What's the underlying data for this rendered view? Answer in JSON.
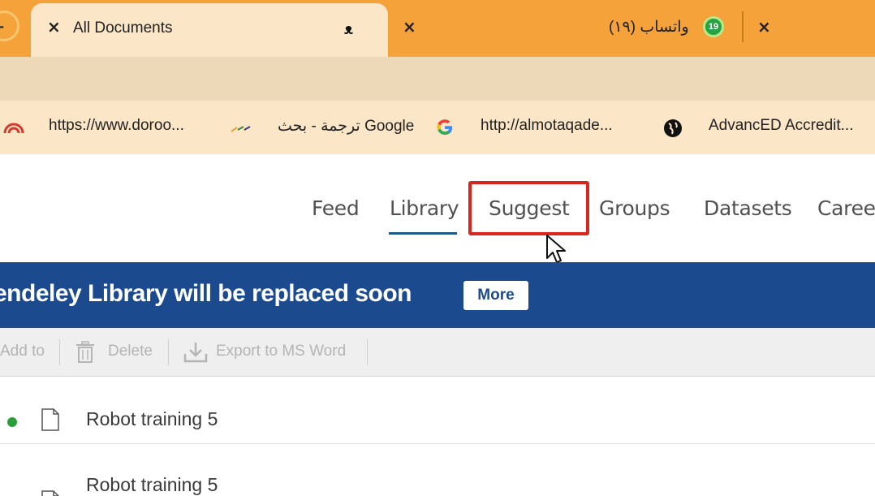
{
  "browser": {
    "profile_initial": "-",
    "tabs": [
      {
        "title": "All Documents",
        "close": "×",
        "favicon": "mendeley-icon",
        "favicon_glyph": "ᴥ"
      },
      {
        "title": "(١٩) واتساب",
        "close": "×",
        "badge": "19",
        "favicon": "whatsapp-icon"
      }
    ],
    "extra_tab_close": "×",
    "colors": {
      "tabstrip": "#f6a23a",
      "active_tab": "#fbe6c7",
      "toolbar": "#edd9b8"
    }
  },
  "bookmarks": [
    {
      "label": "https://www.doroo...",
      "icon": "doroob-icon"
    },
    {
      "label": "ترجمة - بحث Google",
      "icon": "google-icon",
      "prefix_icon": "dash-icon"
    },
    {
      "label": "http://almotaqade...",
      "icon": "globe-icon"
    },
    {
      "label": "AdvancED Accredit...",
      "icon": "globe-icon"
    }
  ],
  "nav": {
    "items": [
      "Feed",
      "Library",
      "Suggest",
      "Groups",
      "Datasets",
      "Caree"
    ],
    "active": "Library",
    "highlighted": "Suggest"
  },
  "banner": {
    "text": "endeley Library will be replaced soon",
    "button": "More",
    "color": "#1c4a8f"
  },
  "actions": [
    {
      "label": "Add to",
      "icon": ""
    },
    {
      "label": "Delete",
      "icon": "trash-icon"
    },
    {
      "label": "Export to MS Word",
      "icon": "download-icon"
    }
  ],
  "documents": [
    {
      "title": "Robot training 5",
      "unread": true
    },
    {
      "title": "Robot training 5",
      "unread": false
    }
  ]
}
